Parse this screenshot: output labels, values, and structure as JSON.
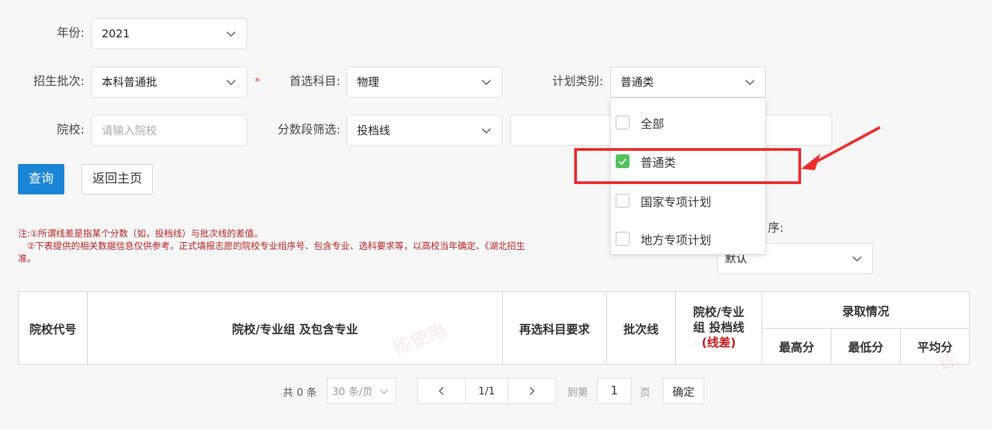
{
  "form": {
    "year_label": "年份:",
    "year_value": "2021",
    "batch_label": "招生批次:",
    "batch_value": "本科普通批",
    "required_mark": "*",
    "subject_label": "首选科目:",
    "subject_value": "物理",
    "plan_label": "计划类别:",
    "plan_value": "普通类",
    "school_label": "院校:",
    "school_placeholder": "请输入院校",
    "score_label": "分数段筛选:",
    "score_value": "投档线",
    "sort_label_partial": "序:",
    "sort_value": "默认"
  },
  "buttons": {
    "query": "查询",
    "back": "返回主页"
  },
  "notes": [
    "注:①所谓线差是指某个分数（如，投档线）与批次线的差值。",
    "　②下表提供的相关数据信息仅供参考。正式填报志愿的院校专业组序号、包含专业、选科要求等，以高校当年确定、《湖北招生",
    "准。"
  ],
  "dropdown": {
    "options": [
      {
        "label": "全部",
        "checked": false
      },
      {
        "label": "普通类",
        "checked": true
      },
      {
        "label": "国家专项计划",
        "checked": false
      },
      {
        "label": "地方专项计划",
        "checked": false
      }
    ]
  },
  "table": {
    "headers": {
      "code": "院校代号",
      "group": "院校/专业组 及包含专业",
      "subjects": "再选科目要求",
      "batch_line": "批次线",
      "tou_line_1": "院校/专业",
      "tou_line_2": "组 投档线",
      "tou_line_3": "(线差)",
      "admission": "录取情况",
      "max": "最高分",
      "min": "最低分",
      "avg": "平均分"
    },
    "watermark": "练使用",
    "watermark2": "练"
  },
  "pagination": {
    "total": "共 0 条",
    "page_size": "30 条/页",
    "current": "1/1",
    "goto_label": "到第",
    "goto_value": "1",
    "page_unit": "页",
    "confirm": "确定"
  },
  "colors": {
    "primary": "#1a85d6",
    "checked": "#52c25a",
    "highlight": "#ee2b2b",
    "note_text": "#b52020"
  }
}
